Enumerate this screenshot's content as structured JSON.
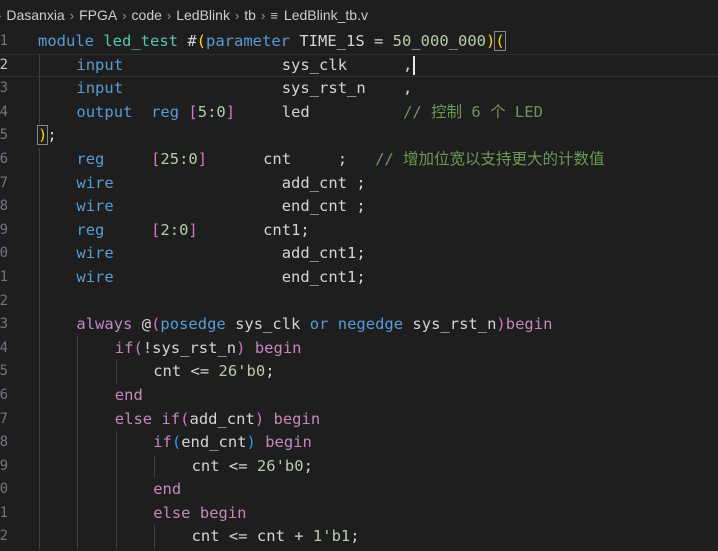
{
  "breadcrumb": {
    "items": [
      "Dasanxia",
      "FPGA",
      "code",
      "LedBlink",
      "tb"
    ],
    "file": "LedBlink_tb.v",
    "separator": "›"
  },
  "editor": {
    "current_line": "2",
    "lines": [
      {
        "n": "1",
        "indent": 0,
        "tokens": [
          {
            "t": "module",
            "c": "kw"
          },
          {
            "t": " "
          },
          {
            "t": "led_test",
            "c": "ty"
          },
          {
            "t": " #"
          },
          {
            "t": "(",
            "c": "br1"
          },
          {
            "t": "parameter",
            "c": "kw"
          },
          {
            "t": " TIME_1S = "
          },
          {
            "t": "50_000_000",
            "c": "num"
          },
          {
            "t": ")",
            "c": "br1"
          },
          {
            "t": "(",
            "c": "br1 match"
          }
        ]
      },
      {
        "n": "2",
        "indent": 1,
        "tokens": [
          {
            "t": "input",
            "c": "kw"
          },
          {
            "t": "                 sys_clk      ,"
          },
          {
            "t": "",
            "c": "cursor"
          }
        ]
      },
      {
        "n": "3",
        "indent": 1,
        "tokens": [
          {
            "t": "input",
            "c": "kw"
          },
          {
            "t": "                 sys_rst_n    ,"
          }
        ]
      },
      {
        "n": "4",
        "indent": 1,
        "tokens": [
          {
            "t": "output",
            "c": "kw"
          },
          {
            "t": "  "
          },
          {
            "t": "reg",
            "c": "kw"
          },
          {
            "t": " "
          },
          {
            "t": "[",
            "c": "br2"
          },
          {
            "t": "5:0",
            "c": "num"
          },
          {
            "t": "]",
            "c": "br2"
          },
          {
            "t": "     led          "
          },
          {
            "t": "// 控制 6 个 LED",
            "c": "cm"
          }
        ]
      },
      {
        "n": "5",
        "indent": 0,
        "tokens": [
          {
            "t": ")",
            "c": "br1 match"
          },
          {
            "t": ";"
          }
        ]
      },
      {
        "n": "6",
        "indent": 1,
        "tokens": [
          {
            "t": "reg",
            "c": "kw"
          },
          {
            "t": "     "
          },
          {
            "t": "[",
            "c": "br2"
          },
          {
            "t": "25:0",
            "c": "num"
          },
          {
            "t": "]",
            "c": "br2"
          },
          {
            "t": "      cnt     ;   "
          },
          {
            "t": "// 增加位宽以支持更大的计数值",
            "c": "cm"
          }
        ]
      },
      {
        "n": "7",
        "indent": 1,
        "tokens": [
          {
            "t": "wire",
            "c": "kw"
          },
          {
            "t": "                  add_cnt ;"
          }
        ]
      },
      {
        "n": "8",
        "indent": 1,
        "tokens": [
          {
            "t": "wire",
            "c": "kw"
          },
          {
            "t": "                  end_cnt ;"
          }
        ]
      },
      {
        "n": "9",
        "indent": 1,
        "tokens": [
          {
            "t": "reg",
            "c": "kw"
          },
          {
            "t": "     "
          },
          {
            "t": "[",
            "c": "br2"
          },
          {
            "t": "2:0",
            "c": "num"
          },
          {
            "t": "]",
            "c": "br2"
          },
          {
            "t": "       cnt1;"
          }
        ]
      },
      {
        "n": "0",
        "indent": 1,
        "tokens": [
          {
            "t": "wire",
            "c": "kw"
          },
          {
            "t": "                  add_cnt1;"
          }
        ]
      },
      {
        "n": "1",
        "indent": 1,
        "tokens": [
          {
            "t": "wire",
            "c": "kw"
          },
          {
            "t": "                  end_cnt1;"
          }
        ]
      },
      {
        "n": "2",
        "indent": 1,
        "tokens": []
      },
      {
        "n": "3",
        "indent": 1,
        "tokens": [
          {
            "t": "always",
            "c": "ctl"
          },
          {
            "t": " @"
          },
          {
            "t": "(",
            "c": "br2"
          },
          {
            "t": "posedge",
            "c": "kw"
          },
          {
            "t": " sys_clk "
          },
          {
            "t": "or",
            "c": "kw"
          },
          {
            "t": " "
          },
          {
            "t": "negedge",
            "c": "kw"
          },
          {
            "t": " sys_rst_n"
          },
          {
            "t": ")",
            "c": "br2"
          },
          {
            "t": "begin",
            "c": "ctl"
          }
        ]
      },
      {
        "n": "4",
        "indent": 2,
        "tokens": [
          {
            "t": "if",
            "c": "ctl"
          },
          {
            "t": "(",
            "c": "br2"
          },
          {
            "t": "!sys_rst_n"
          },
          {
            "t": ")",
            "c": "br2"
          },
          {
            "t": " "
          },
          {
            "t": "begin",
            "c": "ctl"
          }
        ]
      },
      {
        "n": "5",
        "indent": 3,
        "tokens": [
          {
            "t": "cnt <= "
          },
          {
            "t": "26'b0",
            "c": "num"
          },
          {
            "t": ";"
          }
        ]
      },
      {
        "n": "6",
        "indent": 2,
        "tokens": [
          {
            "t": "end",
            "c": "ctl"
          }
        ]
      },
      {
        "n": "7",
        "indent": 2,
        "tokens": [
          {
            "t": "else",
            "c": "ctl"
          },
          {
            "t": " "
          },
          {
            "t": "if",
            "c": "ctl"
          },
          {
            "t": "(",
            "c": "br2"
          },
          {
            "t": "add_cnt"
          },
          {
            "t": ")",
            "c": "br2"
          },
          {
            "t": " "
          },
          {
            "t": "begin",
            "c": "ctl"
          }
        ]
      },
      {
        "n": "8",
        "indent": 3,
        "tokens": [
          {
            "t": "if",
            "c": "ctl"
          },
          {
            "t": "(",
            "c": "br3"
          },
          {
            "t": "end_cnt"
          },
          {
            "t": ")",
            "c": "br3"
          },
          {
            "t": " "
          },
          {
            "t": "begin",
            "c": "ctl"
          }
        ]
      },
      {
        "n": "9",
        "indent": 4,
        "tokens": [
          {
            "t": "cnt <= "
          },
          {
            "t": "26'b0",
            "c": "num"
          },
          {
            "t": ";"
          }
        ]
      },
      {
        "n": "0",
        "indent": 3,
        "tokens": [
          {
            "t": "end",
            "c": "ctl"
          }
        ]
      },
      {
        "n": "1",
        "indent": 3,
        "tokens": [
          {
            "t": "else",
            "c": "ctl"
          },
          {
            "t": " "
          },
          {
            "t": "begin",
            "c": "ctl"
          }
        ]
      },
      {
        "n": "2",
        "indent": 4,
        "tokens": [
          {
            "t": "cnt <= cnt + "
          },
          {
            "t": "1'b1",
            "c": "num"
          },
          {
            "t": ";"
          }
        ]
      }
    ]
  }
}
